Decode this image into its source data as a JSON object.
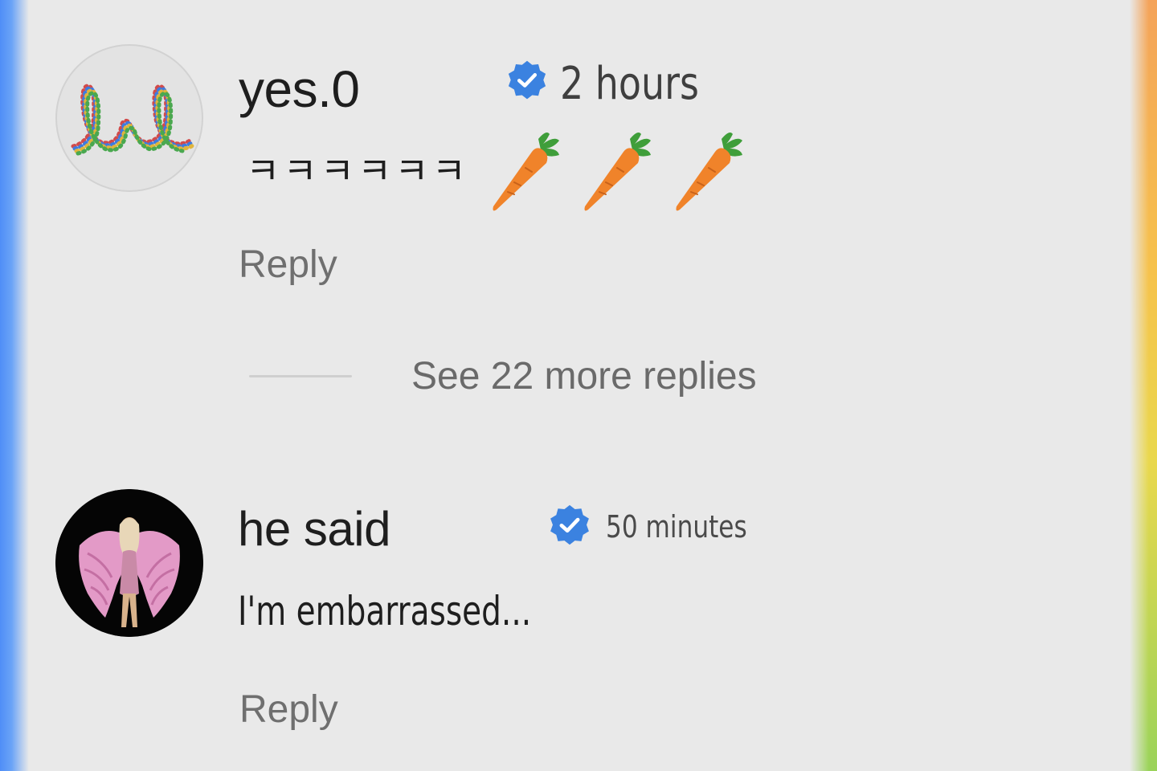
{
  "comments": [
    {
      "username": "yes.0",
      "timestamp": "2 hours",
      "text": "ㅋㅋㅋㅋㅋㅋ",
      "emoji": [
        "carrot",
        "carrot",
        "carrot"
      ],
      "verified": true,
      "reply_label": "Reply"
    },
    {
      "username": "he said",
      "timestamp": "50 minutes",
      "text": "I'm embarrassed...",
      "verified": true,
      "reply_label": "Reply"
    }
  ],
  "more_replies": {
    "label": "See 22 more replies"
  },
  "colors": {
    "background": "#e9e9e9",
    "verified_badge": "#3b82e0",
    "carrot_orange": "#f0832a",
    "carrot_leaf": "#3f9e3a",
    "reply_text": "#6f6f6f"
  },
  "icons": {
    "verified": "verified-badge-icon",
    "carrot": "carrot-emoji-icon"
  }
}
